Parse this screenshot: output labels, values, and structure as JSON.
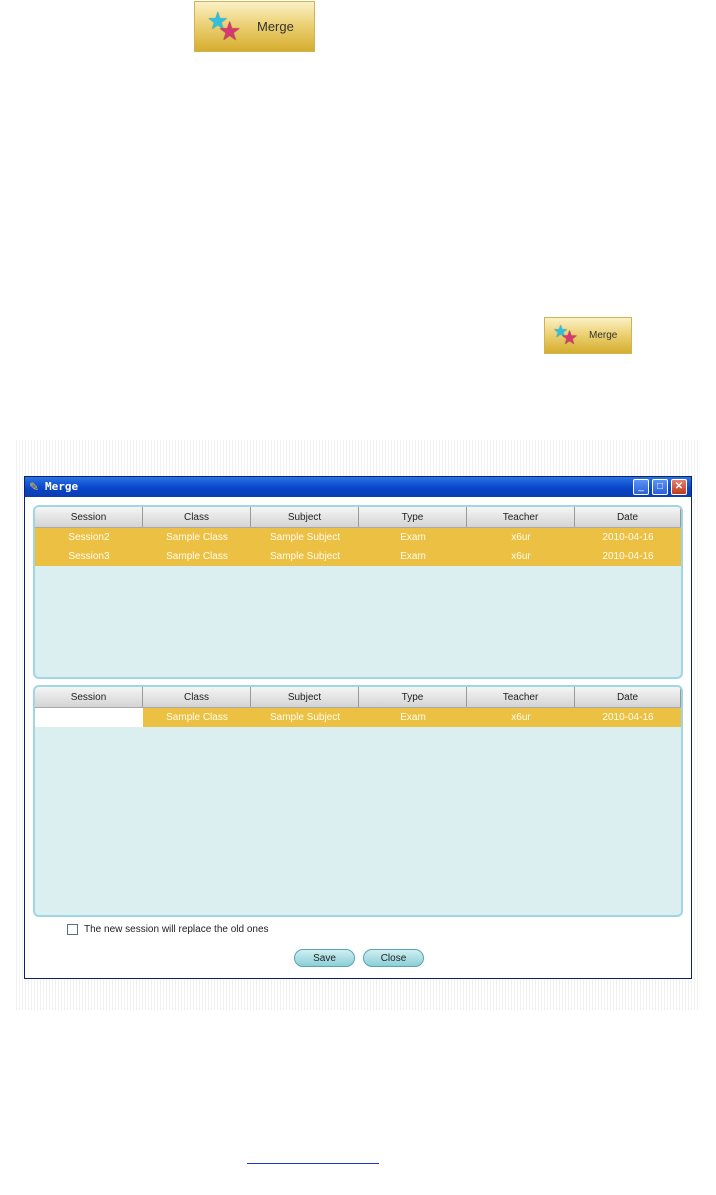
{
  "merge_button_large": {
    "label": "Merge",
    "icon": "stars-icon"
  },
  "merge_button_small": {
    "label": "Merge",
    "icon": "stars-icon"
  },
  "window": {
    "title": "Merge",
    "icon": "app-icon",
    "controls": {
      "minimize": "minimize-icon",
      "maximize": "maximize-icon",
      "close_glyph": "✕"
    }
  },
  "columns": [
    "Session",
    "Class",
    "Subject",
    "Type",
    "Teacher",
    "Date"
  ],
  "top_rows": [
    [
      "Session2",
      "Sample Class",
      "Sample Subject",
      "Exam",
      "x6ur",
      "2010-04-16"
    ],
    [
      "Session3",
      "Sample Class",
      "Sample Subject",
      "Exam",
      "x6ur",
      "2010-04-16"
    ]
  ],
  "bottom_rows": [
    [
      "",
      "Sample Class",
      "Sample Subject",
      "Exam",
      "x6ur",
      "2010-04-16"
    ]
  ],
  "replace_checkbox": {
    "label": "The new session will replace the old ones",
    "checked": false
  },
  "buttons": {
    "save": "Save",
    "close": "Close"
  },
  "colors": {
    "selected_row": "#ecc043",
    "panel_bg": "#dbeef0",
    "title_bar": "#0a46c8"
  }
}
